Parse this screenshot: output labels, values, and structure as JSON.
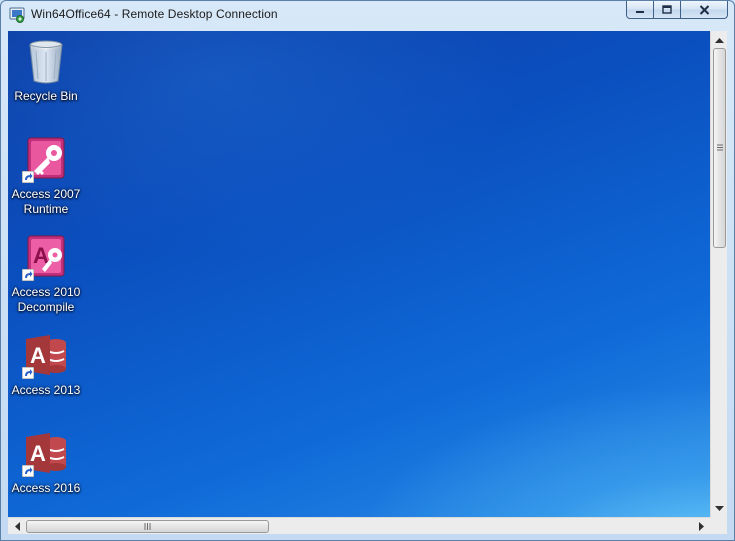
{
  "window": {
    "title": "Win64Office64 - Remote Desktop Connection",
    "title_icon": "remote-desktop-icon",
    "controls": [
      "minimize-icon",
      "maximize-icon",
      "close-icon"
    ]
  },
  "desktop": {
    "icons": [
      {
        "label": "Recycle Bin",
        "icon": "recycle-bin-icon",
        "shortcut": false
      },
      {
        "label": "Access 2007\nRuntime",
        "icon": "access-2007-runtime-icon",
        "shortcut": true
      },
      {
        "label": "Access 2010\nDecompile",
        "icon": "access-2010-icon",
        "shortcut": true
      },
      {
        "label": "Access 2013",
        "icon": "access-2013-icon",
        "shortcut": true
      },
      {
        "label": "Access 2016",
        "icon": "access-2016-icon",
        "shortcut": true
      }
    ]
  },
  "colors": {
    "desktop_blue": "#0b4fbf",
    "access_old_pink": "#b0266a",
    "access_new_red": "#a4373a"
  }
}
